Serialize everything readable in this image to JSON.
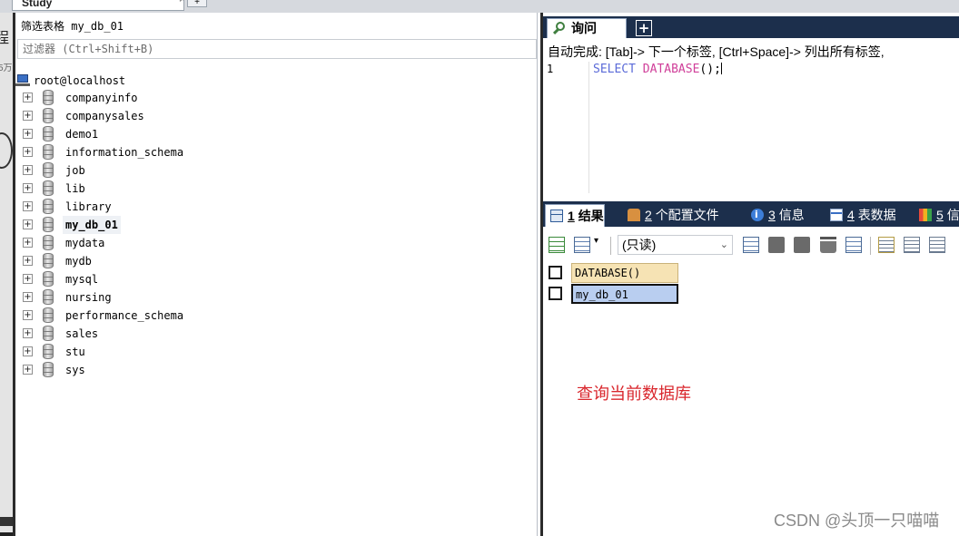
{
  "window": {
    "doc_tab_label": "Study",
    "doc_tab_close": "×",
    "new_doc_tab": "+",
    "edge_glyph_1": "程",
    "edge_glyph_2": "5万"
  },
  "object_browser": {
    "filter_title": "筛选表格 my_db_01",
    "filter_placeholder": "过滤器 (Ctrl+Shift+B)",
    "root_label": "root@localhost",
    "expander": "+",
    "databases": [
      "companyinfo",
      "companysales",
      "demo1",
      "information_schema",
      "job",
      "lib",
      "library",
      "my_db_01",
      "mydata",
      "mydb",
      "mysql",
      "nursing",
      "performance_schema",
      "sales",
      "stu",
      "sys"
    ],
    "selected_database": "my_db_01"
  },
  "query": {
    "tab_label": "询问",
    "add_tab": "+",
    "autocomplete_hint": "自动完成: [Tab]-> 下一个标签, [Ctrl+Space]-> 列出所有标签,",
    "line_number": "1",
    "sql": {
      "keyword": "SELECT",
      "function": "DATABASE",
      "rest": "();"
    }
  },
  "results_tabs": [
    {
      "num": "1",
      "label": "结果",
      "icon": "grid-icon",
      "active": true
    },
    {
      "num": "2",
      "label": "个配置文件",
      "icon": "profile-icon",
      "active": false
    },
    {
      "num": "3",
      "label": "信息",
      "icon": "info-icon",
      "active": false
    },
    {
      "num": "4",
      "label": "表数据",
      "icon": "table-icon",
      "active": false
    },
    {
      "num": "5",
      "label": "信",
      "icon": "info-colors-icon",
      "active": false
    }
  ],
  "results_toolbar": {
    "mode_select_value": "(只读)",
    "mode_select_chevron": "⌄",
    "dropdown_caret": "▾"
  },
  "result_grid": {
    "column_header": "DATABASE()",
    "rows": [
      "my_db_01"
    ]
  },
  "annotation_text": "查询当前数据库",
  "watermark": "CSDN @头顶一只喵喵",
  "colors": {
    "panel_bar": "#1c2f4c",
    "sql_keyword": "#5b6bd8",
    "sql_function": "#d0409a",
    "annotation": "#d9262c",
    "grid_header": "#f6e3b4",
    "grid_selected_cell": "#b9cef0"
  }
}
